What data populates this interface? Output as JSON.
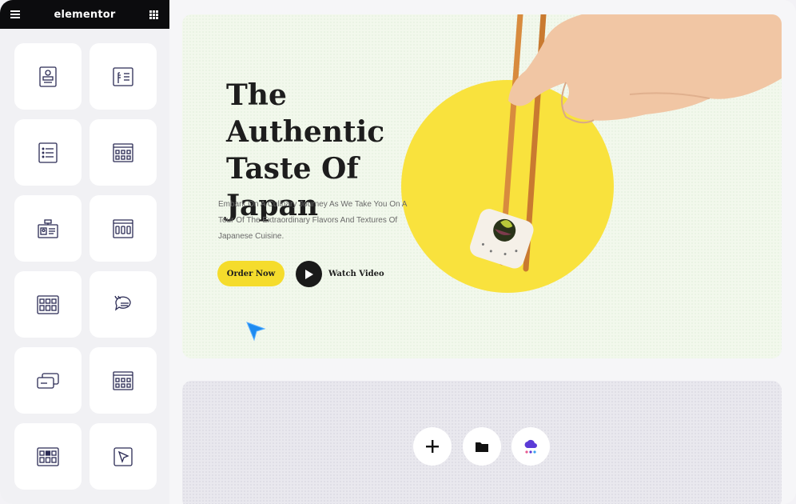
{
  "app": {
    "brand": "elementor"
  },
  "sidebar": {
    "menu_icon": "hamburger-icon",
    "grid_icon": "apps-grid-icon",
    "widgets": [
      {
        "icon": "profile-card-icon"
      },
      {
        "icon": "facebook-embed-icon"
      },
      {
        "icon": "list-icon"
      },
      {
        "icon": "table-grid-icon"
      },
      {
        "icon": "id-card-icon"
      },
      {
        "icon": "browser-columns-icon"
      },
      {
        "icon": "image-gallery-icon"
      },
      {
        "icon": "testimonial-quote-icon"
      },
      {
        "icon": "cards-stack-icon"
      },
      {
        "icon": "table-grid-icon"
      },
      {
        "icon": "media-grid-icon"
      },
      {
        "icon": "mouse-click-icon"
      }
    ]
  },
  "hero": {
    "title_line1": "The Authentic",
    "title_line2": "Taste Of",
    "title_line3": "Japan",
    "description": "Embark On A Culinary Journey As We Take You On A Tour Of The Extraordinary Flavors And Textures Of Japanese Cuisine.",
    "order_label": "Order Now",
    "watch_label": "Watch Video"
  },
  "section_actions": [
    {
      "icon": "plus-icon"
    },
    {
      "icon": "folder-icon"
    },
    {
      "icon": "ai-cloud-icon"
    }
  ],
  "colors": {
    "accent_yellow": "#f5dc2c",
    "dark": "#0c0c0e",
    "canvas_bg": "#f2f8ec",
    "cursor_blue": "#1e8bf0"
  }
}
